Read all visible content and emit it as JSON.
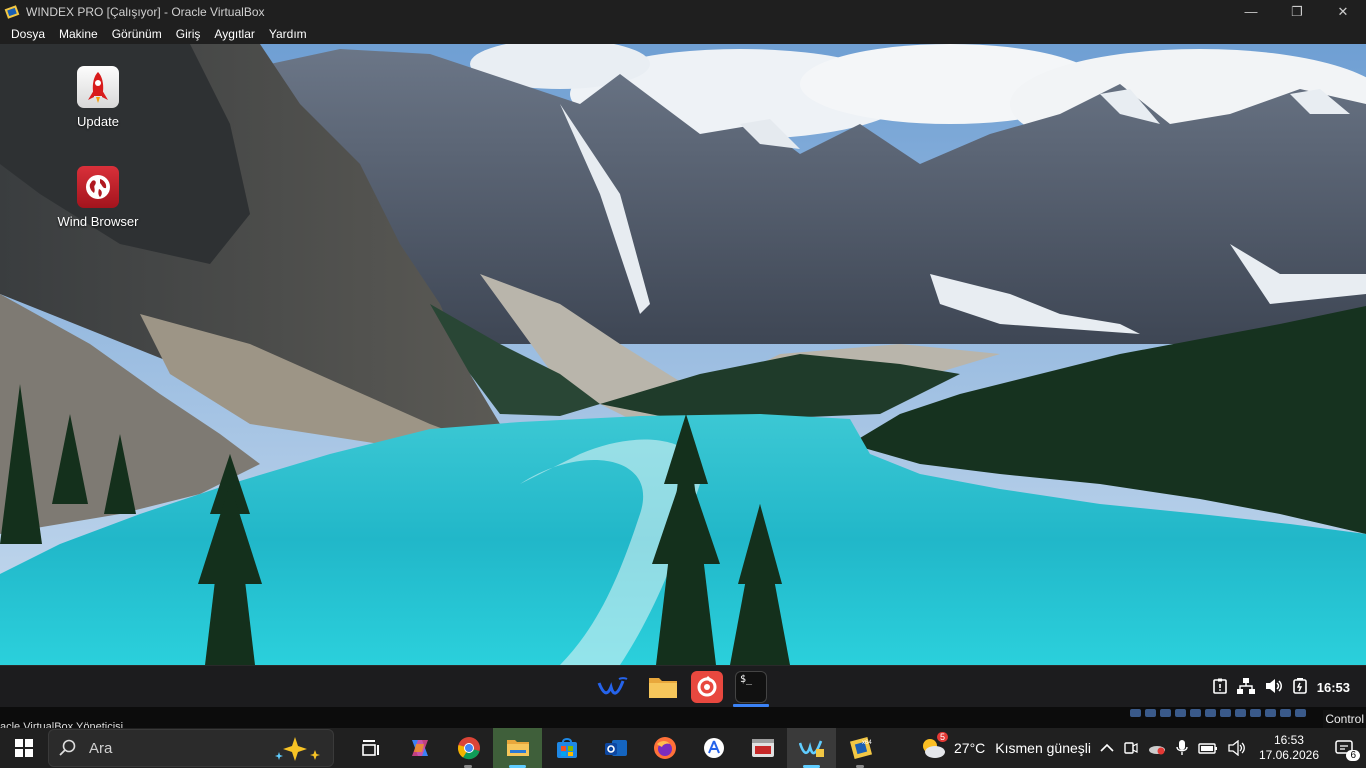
{
  "window": {
    "title": "WINDEX PRO [Çalışıyor] - Oracle VirtualBox",
    "menu": [
      "Dosya",
      "Makine",
      "Görünüm",
      "Giriş",
      "Aygıtlar",
      "Yardım"
    ]
  },
  "desktop": {
    "icons": [
      {
        "label": "Update",
        "icon": "rocket-icon"
      },
      {
        "label": "Wind Browser",
        "icon": "globe-icon"
      }
    ]
  },
  "guest_panel": {
    "apps": [
      "wind-logo-icon",
      "folder-icon",
      "browser-icon",
      "terminal-icon"
    ],
    "clock": "16:53"
  },
  "vb_status": {
    "left_text": "acle VirtualBox Yöneticisi",
    "host_key": "Control"
  },
  "taskbar": {
    "search_placeholder": "Ara",
    "weather_temp": "27°C",
    "weather_text": "Kısmen güneşli",
    "time": "16:53",
    "date": "17.06.2026",
    "notification_count": "6",
    "weather_badge": "5"
  },
  "colors": {
    "accent": "#60cdff",
    "taskbar": "#202020",
    "lake": "#2fc4d3"
  }
}
